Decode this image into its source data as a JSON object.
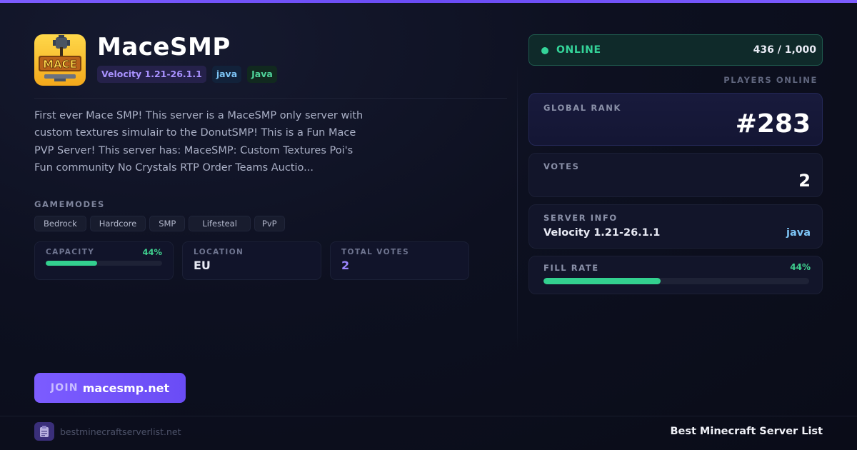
{
  "server": {
    "name": "MaceSMP",
    "logo_text": "MACE",
    "tags": {
      "version": "Velocity 1.21-26.1.1",
      "platform": "java",
      "edition": "Java"
    },
    "description": "First ever Mace SMP! This server is a MaceSMP only server with custom textures simulair to the DonutSMP! This is a Fun Mace PVP Server! This server has: MaceSMP: Custom Textures Poi's Fun community No Crystals RTP Order Teams Auctio...",
    "gamemodes_label": "GAMEMODES",
    "gamemodes": [
      "Bedrock",
      "Hardcore",
      "SMP",
      "Lifesteal",
      "PvP"
    ]
  },
  "stats": {
    "capacity": {
      "label": "CAPACITY",
      "percent_text": "44%",
      "fraction": 0.44
    },
    "location": {
      "label": "LOCATION",
      "value": "EU"
    },
    "total_votes": {
      "label": "TOTAL VOTES",
      "value": "2"
    }
  },
  "join": {
    "prefix": "JOIN",
    "address": "macesmp.net"
  },
  "status": {
    "state": "ONLINE",
    "players": "436 / 1,000",
    "players_label": "PLAYERS ONLINE"
  },
  "cards": {
    "rank": {
      "label": "GLOBAL RANK",
      "value": "#283"
    },
    "votes": {
      "label": "VOTES",
      "value": "2"
    },
    "server_info": {
      "label": "SERVER INFO",
      "version": "Velocity 1.21-26.1.1",
      "platform": "java"
    },
    "fill_rate": {
      "label": "FILL RATE",
      "percent_text": "44%",
      "fraction": 0.44
    }
  },
  "footer": {
    "site": "bestminecraftserverlist.net",
    "brand": "Best Minecraft Server List"
  },
  "colors": {
    "accent": "#7c5cff",
    "online_green": "#34d399",
    "java_blue": "#7cc3f4"
  }
}
